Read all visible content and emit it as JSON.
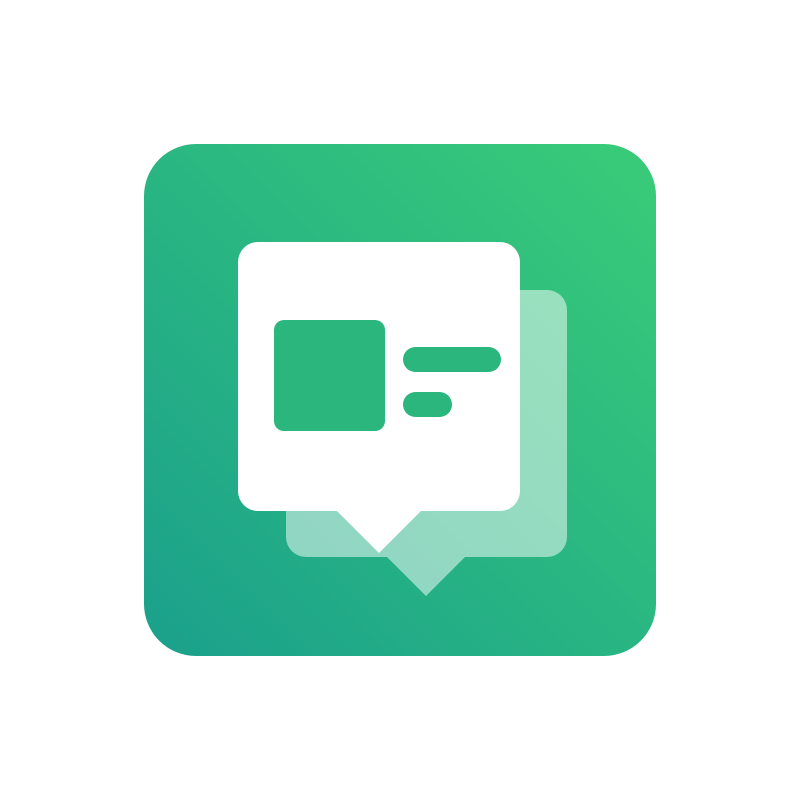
{
  "app_icon": {
    "icon": "chat-bubbles-icon",
    "colors": {
      "page_background": "#ffffff",
      "tile_gradient_start": "#1aa08c",
      "tile_gradient_end": "#3acc78",
      "front_bubble": "#ffffff",
      "back_bubble": "#ffffff",
      "back_bubble_opacity": "0.5",
      "content_accent": "#2bb67e"
    }
  }
}
